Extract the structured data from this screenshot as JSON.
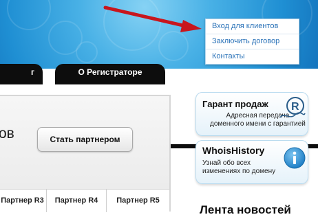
{
  "top_links": [
    "Вход для клиентов",
    "Заключить договор",
    "Контакты"
  ],
  "nav": {
    "tab_left": "г",
    "tab_about": "О Регистраторе"
  },
  "main": {
    "heading_fragment": "ов",
    "partner_button": "Стать партнером",
    "columns": [
      "Партнер R3",
      "Партнер R4",
      "Партнер R5"
    ]
  },
  "sidebar": {
    "card1": {
      "title": "Гарант продаж",
      "desc_line1": "Адресная передача",
      "desc_line2": "доменного имени с гарантией"
    },
    "card2": {
      "title": "WhoisHistory",
      "desc_line1": "Узнай обо всех",
      "desc_line2": "изменениях по домену"
    },
    "news_title": "Лента новостей"
  },
  "colors": {
    "accent_blue": "#1f8fd3",
    "arrow_red": "#c8161d",
    "info_blue": "#2c8fd4"
  }
}
